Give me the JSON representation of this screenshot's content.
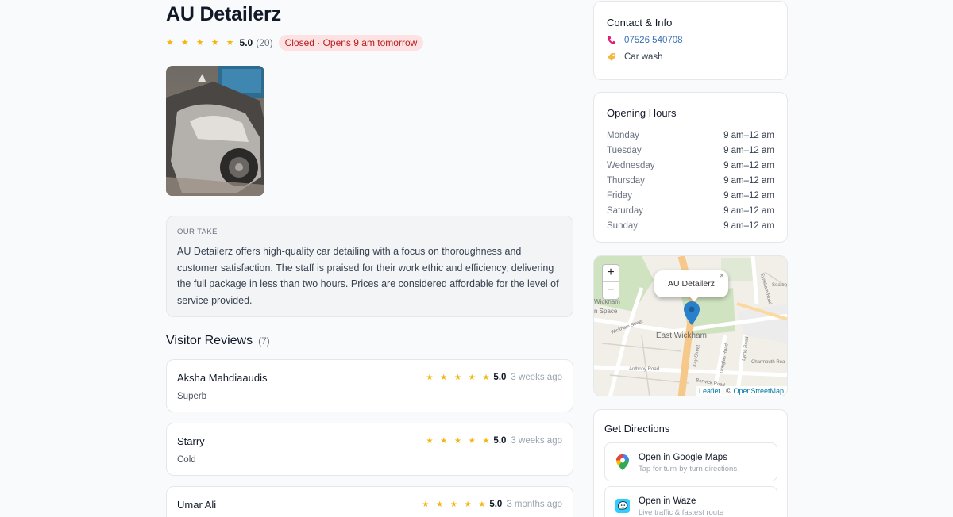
{
  "business": {
    "name": "AU Detailerz",
    "stars": "★ ★ ★ ★ ★",
    "rating": "5.0",
    "review_count": "(20)",
    "status": "Closed · Opens 9 am tomorrow"
  },
  "our_take": {
    "label": "OUR TAKE",
    "text": "AU Detailerz offers high-quality car detailing with a focus on thoroughness and customer satisfaction. The staff is praised for their work ethic and efficiency, delivering the full package in less than two hours. Prices are considered affordable for the level of service provided."
  },
  "reviews": {
    "title": "Visitor Reviews",
    "count": "(7)",
    "items": [
      {
        "author": "Aksha Mahdiaaudis",
        "stars": "★ ★ ★ ★ ★",
        "score": "5.0",
        "time": "3 weeks ago",
        "text": "Superb"
      },
      {
        "author": "Starry",
        "stars": "★ ★ ★ ★ ★",
        "score": "5.0",
        "time": "3 weeks ago",
        "text": "Cold"
      },
      {
        "author": "Umar Ali",
        "stars": "★ ★ ★ ★ ★",
        "score": "5.0",
        "time": "3 months ago",
        "text": ""
      }
    ]
  },
  "contact": {
    "title": "Contact & Info",
    "phone": "07526 540708",
    "category": "Car wash"
  },
  "hours": {
    "title": "Opening Hours",
    "rows": [
      {
        "day": "Monday",
        "time": "9 am–12 am"
      },
      {
        "day": "Tuesday",
        "time": "9 am–12 am"
      },
      {
        "day": "Wednesday",
        "time": "9 am–12 am"
      },
      {
        "day": "Thursday",
        "time": "9 am–12 am"
      },
      {
        "day": "Friday",
        "time": "9 am–12 am"
      },
      {
        "day": "Saturday",
        "time": "9 am–12 am"
      },
      {
        "day": "Sunday",
        "time": "9 am–12 am"
      }
    ]
  },
  "map": {
    "zoom_in": "+",
    "zoom_out": "−",
    "popup_label": "AU Detailerz",
    "popup_close": "×",
    "place_label": "East Wickham",
    "street_labels": [
      "Wickham Street",
      "Anthony Road",
      "Berwick Road",
      "Kay Street",
      "Douglas Road",
      "Lyme Road",
      "Charmouth Roa",
      "Eynsham Road",
      "Seaton",
      "Wickham",
      "n Space"
    ],
    "attribution_leaflet": "Leaflet",
    "attribution_sep": " | © ",
    "attribution_osm": "OpenStreetMap"
  },
  "directions": {
    "title": "Get Directions",
    "options": [
      {
        "name": "Open in Google Maps",
        "sub": "Tap for turn-by-turn directions"
      },
      {
        "name": "Open in Waze",
        "sub": "Live traffic & fastest route"
      }
    ]
  },
  "colors": {
    "star": "#f5b50a",
    "status_bg": "#fde2e4",
    "status_text": "#b91c1c",
    "link": "#3b6fb3",
    "map_pin": "#2a81cb"
  },
  "icons": {
    "phone": "phone-icon",
    "category": "tag-icon",
    "google_maps": "google-maps-icon",
    "waze": "waze-icon",
    "pin": "map-pin-icon"
  }
}
